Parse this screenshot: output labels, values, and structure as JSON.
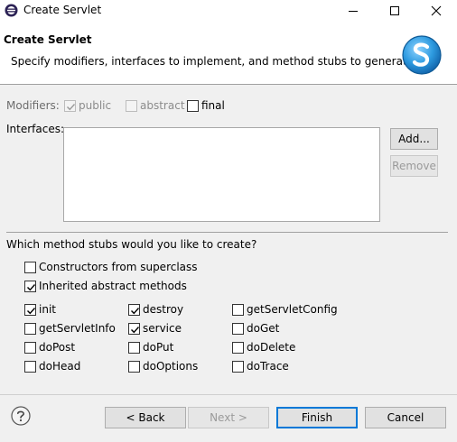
{
  "window": {
    "title": "Create Servlet"
  },
  "banner": {
    "title": "Create Servlet",
    "description": "Specify modifiers, interfaces to implement, and method stubs to generate."
  },
  "modifiers": {
    "label": "Modifiers:",
    "public_label": "public",
    "public_checked": true,
    "abstract_label": "abstract",
    "abstract_checked": false,
    "final_label": "final",
    "final_checked": false
  },
  "interfaces": {
    "label": "Interfaces:",
    "add_label": "Add...",
    "remove_label": "Remove"
  },
  "stubs": {
    "question": "Which method stubs would you like to create?",
    "constructors_label": "Constructors from superclass",
    "constructors_checked": false,
    "inherited_label": "Inherited abstract methods",
    "inherited_checked": true,
    "methods": [
      {
        "label": "init",
        "checked": true
      },
      {
        "label": "destroy",
        "checked": true
      },
      {
        "label": "getServletConfig",
        "checked": false
      },
      {
        "label": "getServletInfo",
        "checked": false
      },
      {
        "label": "service",
        "checked": true
      },
      {
        "label": "doGet",
        "checked": false
      },
      {
        "label": "doPost",
        "checked": false
      },
      {
        "label": "doPut",
        "checked": false
      },
      {
        "label": "doDelete",
        "checked": false
      },
      {
        "label": "doHead",
        "checked": false
      },
      {
        "label": "doOptions",
        "checked": false
      },
      {
        "label": "doTrace",
        "checked": false
      }
    ]
  },
  "footer": {
    "back_label": "< Back",
    "next_label": "Next >",
    "finish_label": "Finish",
    "cancel_label": "Cancel"
  },
  "icons": {
    "app": "eclipse-icon",
    "minimize": "minimize-icon",
    "maximize": "maximize-icon",
    "close": "close-icon",
    "banner": "servlet-logo-icon",
    "help": "help-icon",
    "check": "checkmark-icon"
  },
  "colors": {
    "accent": "#0078d7",
    "logo": "#3aa3e3"
  }
}
